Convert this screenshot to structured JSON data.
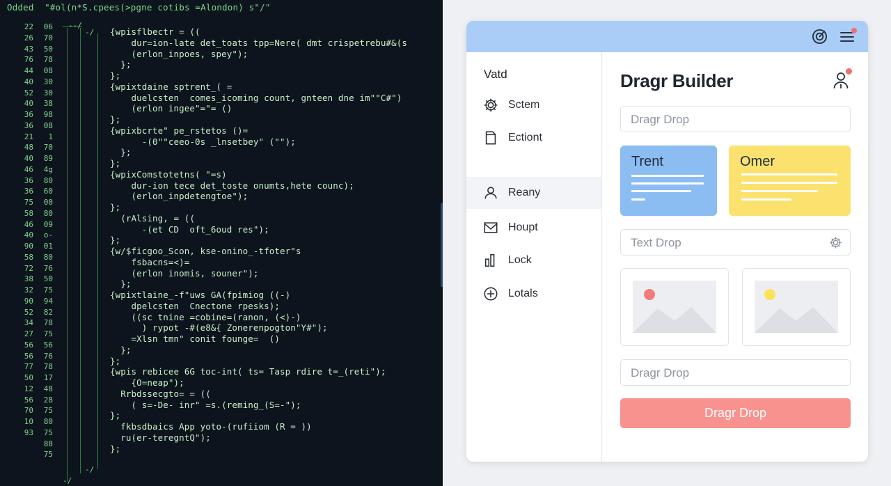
{
  "editor": {
    "header": "Odded  \"#ol(n*S.cpees(>pgne cotibs =Alondon) s\"/\"",
    "gutter_a": [
      "22",
      "26",
      "43",
      "76",
      "44",
      "40",
      "52",
      "40",
      "36",
      "36",
      "21",
      "48",
      "40",
      "46",
      "36",
      "36",
      "75",
      "58",
      "46",
      "40",
      "90",
      "58",
      "72",
      "38",
      "32",
      "90",
      "52",
      "34",
      "27",
      "56",
      "56",
      "77",
      "50",
      "12",
      "56",
      "70",
      "10",
      "93",
      "",
      ""
    ],
    "gutter_b": [
      "06",
      "70",
      "50",
      "78",
      "08",
      "30",
      "30",
      "38",
      "98",
      "08",
      "1",
      "70",
      "89",
      "4g",
      "80",
      "60",
      "00",
      "80",
      "09",
      "o-",
      "01",
      "80",
      "76",
      "50",
      "75",
      "94",
      "82",
      "78",
      "75",
      "56",
      "76",
      "78",
      "17",
      "48",
      "28",
      "75",
      "80",
      "75",
      "88",
      "75"
    ],
    "top_tick": "--/",
    "mid_tick": "-/",
    "bottom_ticks": [
      "-/",
      "-/"
    ],
    "lines": [
      "{wpisflbectr = ((",
      "    dur=ion-late det_toats tpp=Nere( dmt crispetrebu#&(s",
      "    (erlon_inpoes, spey\");",
      "  };",
      "};",
      "{wpixtdaine sptrent_( =",
      "    duelcsten  comes_icoming count, gnteen dne im\"\"C#\")",
      "    (erlon ingee\"=\"= ()",
      "};",
      "{wpixbcrte\" pe_rstetos ()=",
      "      -(0\"\"ceeo-0s _lnsetbey\" (\"\");",
      "  };",
      "};",
      "{wpixComstotetns( \"=s)",
      "    dur-ion tece det_toste onumts,hete counc);",
      "    (erlon_inpdetengtoe\");",
      "};",
      "  (rAlsing, = ((",
      "      -(et CD  oft_6oud res\");",
      "};",
      "{w/$ficgoo_Scon, kse-onino_-tfoter\"s",
      "    fsbacns=<)=",
      "    (erlon inomis, souner\");",
      "  };",
      "{wpixtlaine_-f\"uws GA(fpimiog ((-)",
      "    dpelcsten  Cnectone rpesks);",
      "    ((sc tnine =cobine=(ranon, (<)-)",
      "      ) rypot -#(e8&{ Zonerenpogton\"Y#\");",
      "    =Xlsn tmn\" conit founge=  ()",
      "  };",
      "};",
      "{wpis rebicee 6G toc-int( ts= Tasp rdire t=_(reti\");",
      "    {O=neap\");",
      "  Rrbdssecgto= = ((",
      "    ( s=-De- inr\" =s.(reming_(S=-\");",
      "};",
      "  fkbsdbaics App yoto-(rufiiom (R = ))",
      "  ru(er-teregntQ\");",
      "};"
    ]
  },
  "app": {
    "sidebar": {
      "title": "Vatd",
      "items": [
        {
          "label": "Sctem",
          "icon": "gear-icon"
        },
        {
          "label": "Ectiont",
          "icon": "document-icon"
        },
        {
          "label": "Reany",
          "icon": "user-icon"
        },
        {
          "label": "Houpt",
          "icon": "mail-icon"
        },
        {
          "label": "Lock",
          "icon": "bar-chart-icon"
        },
        {
          "label": "Lotals",
          "icon": "plus-circle-icon"
        }
      ]
    },
    "main": {
      "title": "Dragr Builder",
      "top_field_placeholder": "Dragr Drop",
      "cards": [
        {
          "title": "Trent",
          "color": "#8bbcf2"
        },
        {
          "title": "Omer",
          "color": "#fbe26e"
        }
      ],
      "text_field_placeholder": "Text Drop",
      "image_dots": [
        "#f47b7b",
        "#f8e35a"
      ],
      "bottom_field_placeholder": "Dragr Drop",
      "button_label": "Dragr Drop"
    },
    "colors": {
      "titlebar": "#a9cdf6",
      "button": "#f8928e",
      "notification": "#f07070"
    }
  }
}
